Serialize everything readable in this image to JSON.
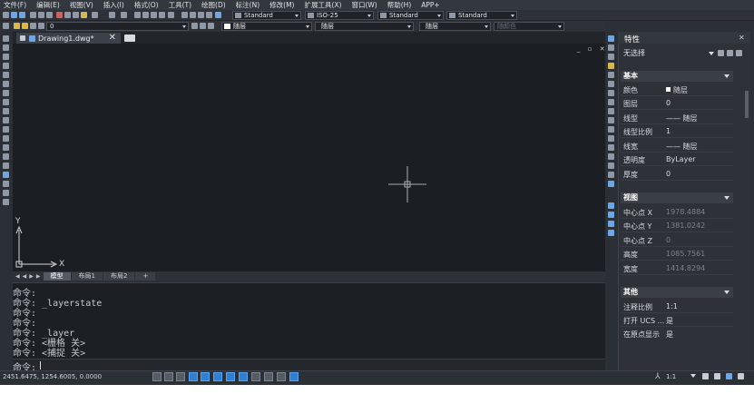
{
  "menu": [
    "文件(F)",
    "编辑(E)",
    "视图(V)",
    "插入(I)",
    "格式(O)",
    "工具(T)",
    "绘图(D)",
    "标注(N)",
    "修改(M)",
    "扩展工具(X)",
    "窗口(W)",
    "帮助(H)",
    "APP+"
  ],
  "toolbar": {
    "text_style": "Standard",
    "dim_style": "ISO-25",
    "table_style": "Standard",
    "multileader_style": "Standard",
    "layer": "0",
    "color": "随层",
    "linetype": "随层",
    "lineweight": "随层",
    "plot_style": "随颜色"
  },
  "document": {
    "tab_title": "Drawing1.dwg*",
    "close_label": "✕",
    "win_controls": "_ ▫ ✕"
  },
  "ucs": {
    "x_label": "X",
    "y_label": "Y"
  },
  "layouts": {
    "model": "模型",
    "layout1": "布局1",
    "layout2": "布局2",
    "add": "+"
  },
  "command": {
    "history": [
      "命令:",
      "命令: _layerstate",
      "命令:",
      "命令:",
      "命令: _layer",
      "命令: <栅格 关>",
      "命令: <捕捉 关>"
    ],
    "prompt": "命令:"
  },
  "status": {
    "coords": "2451.6475, 1254.6005, 0.0000",
    "scale": "1:1"
  },
  "properties": {
    "title": "特性",
    "selection": "无选择",
    "sections": {
      "basic": "基本",
      "view": "视图",
      "misc": "其他"
    },
    "basic": [
      {
        "key": "颜色",
        "value": "随层",
        "swatch": "#ffffff"
      },
      {
        "key": "图层",
        "value": "0"
      },
      {
        "key": "线型",
        "value": "—— 随层"
      },
      {
        "key": "线型比例",
        "value": "1"
      },
      {
        "key": "线宽",
        "value": "—— 随层"
      },
      {
        "key": "透明度",
        "value": "ByLayer"
      },
      {
        "key": "厚度",
        "value": "0"
      }
    ],
    "view": [
      {
        "key": "中心点 X",
        "value": "1978.4884"
      },
      {
        "key": "中心点 Y",
        "value": "1381.0242"
      },
      {
        "key": "中心点 Z",
        "value": "0"
      },
      {
        "key": "高度",
        "value": "1085.7561"
      },
      {
        "key": "宽度",
        "value": "1414.8294"
      }
    ],
    "misc": [
      {
        "key": "注释比例",
        "value": "1:1"
      },
      {
        "key": "打开 UCS ...",
        "value": "是"
      },
      {
        "key": "在原点显示",
        "value": "是"
      }
    ]
  },
  "colors": {
    "accent": "#2f7fd1",
    "canvas": "#1b1e23",
    "panel": "#2e3238"
  }
}
